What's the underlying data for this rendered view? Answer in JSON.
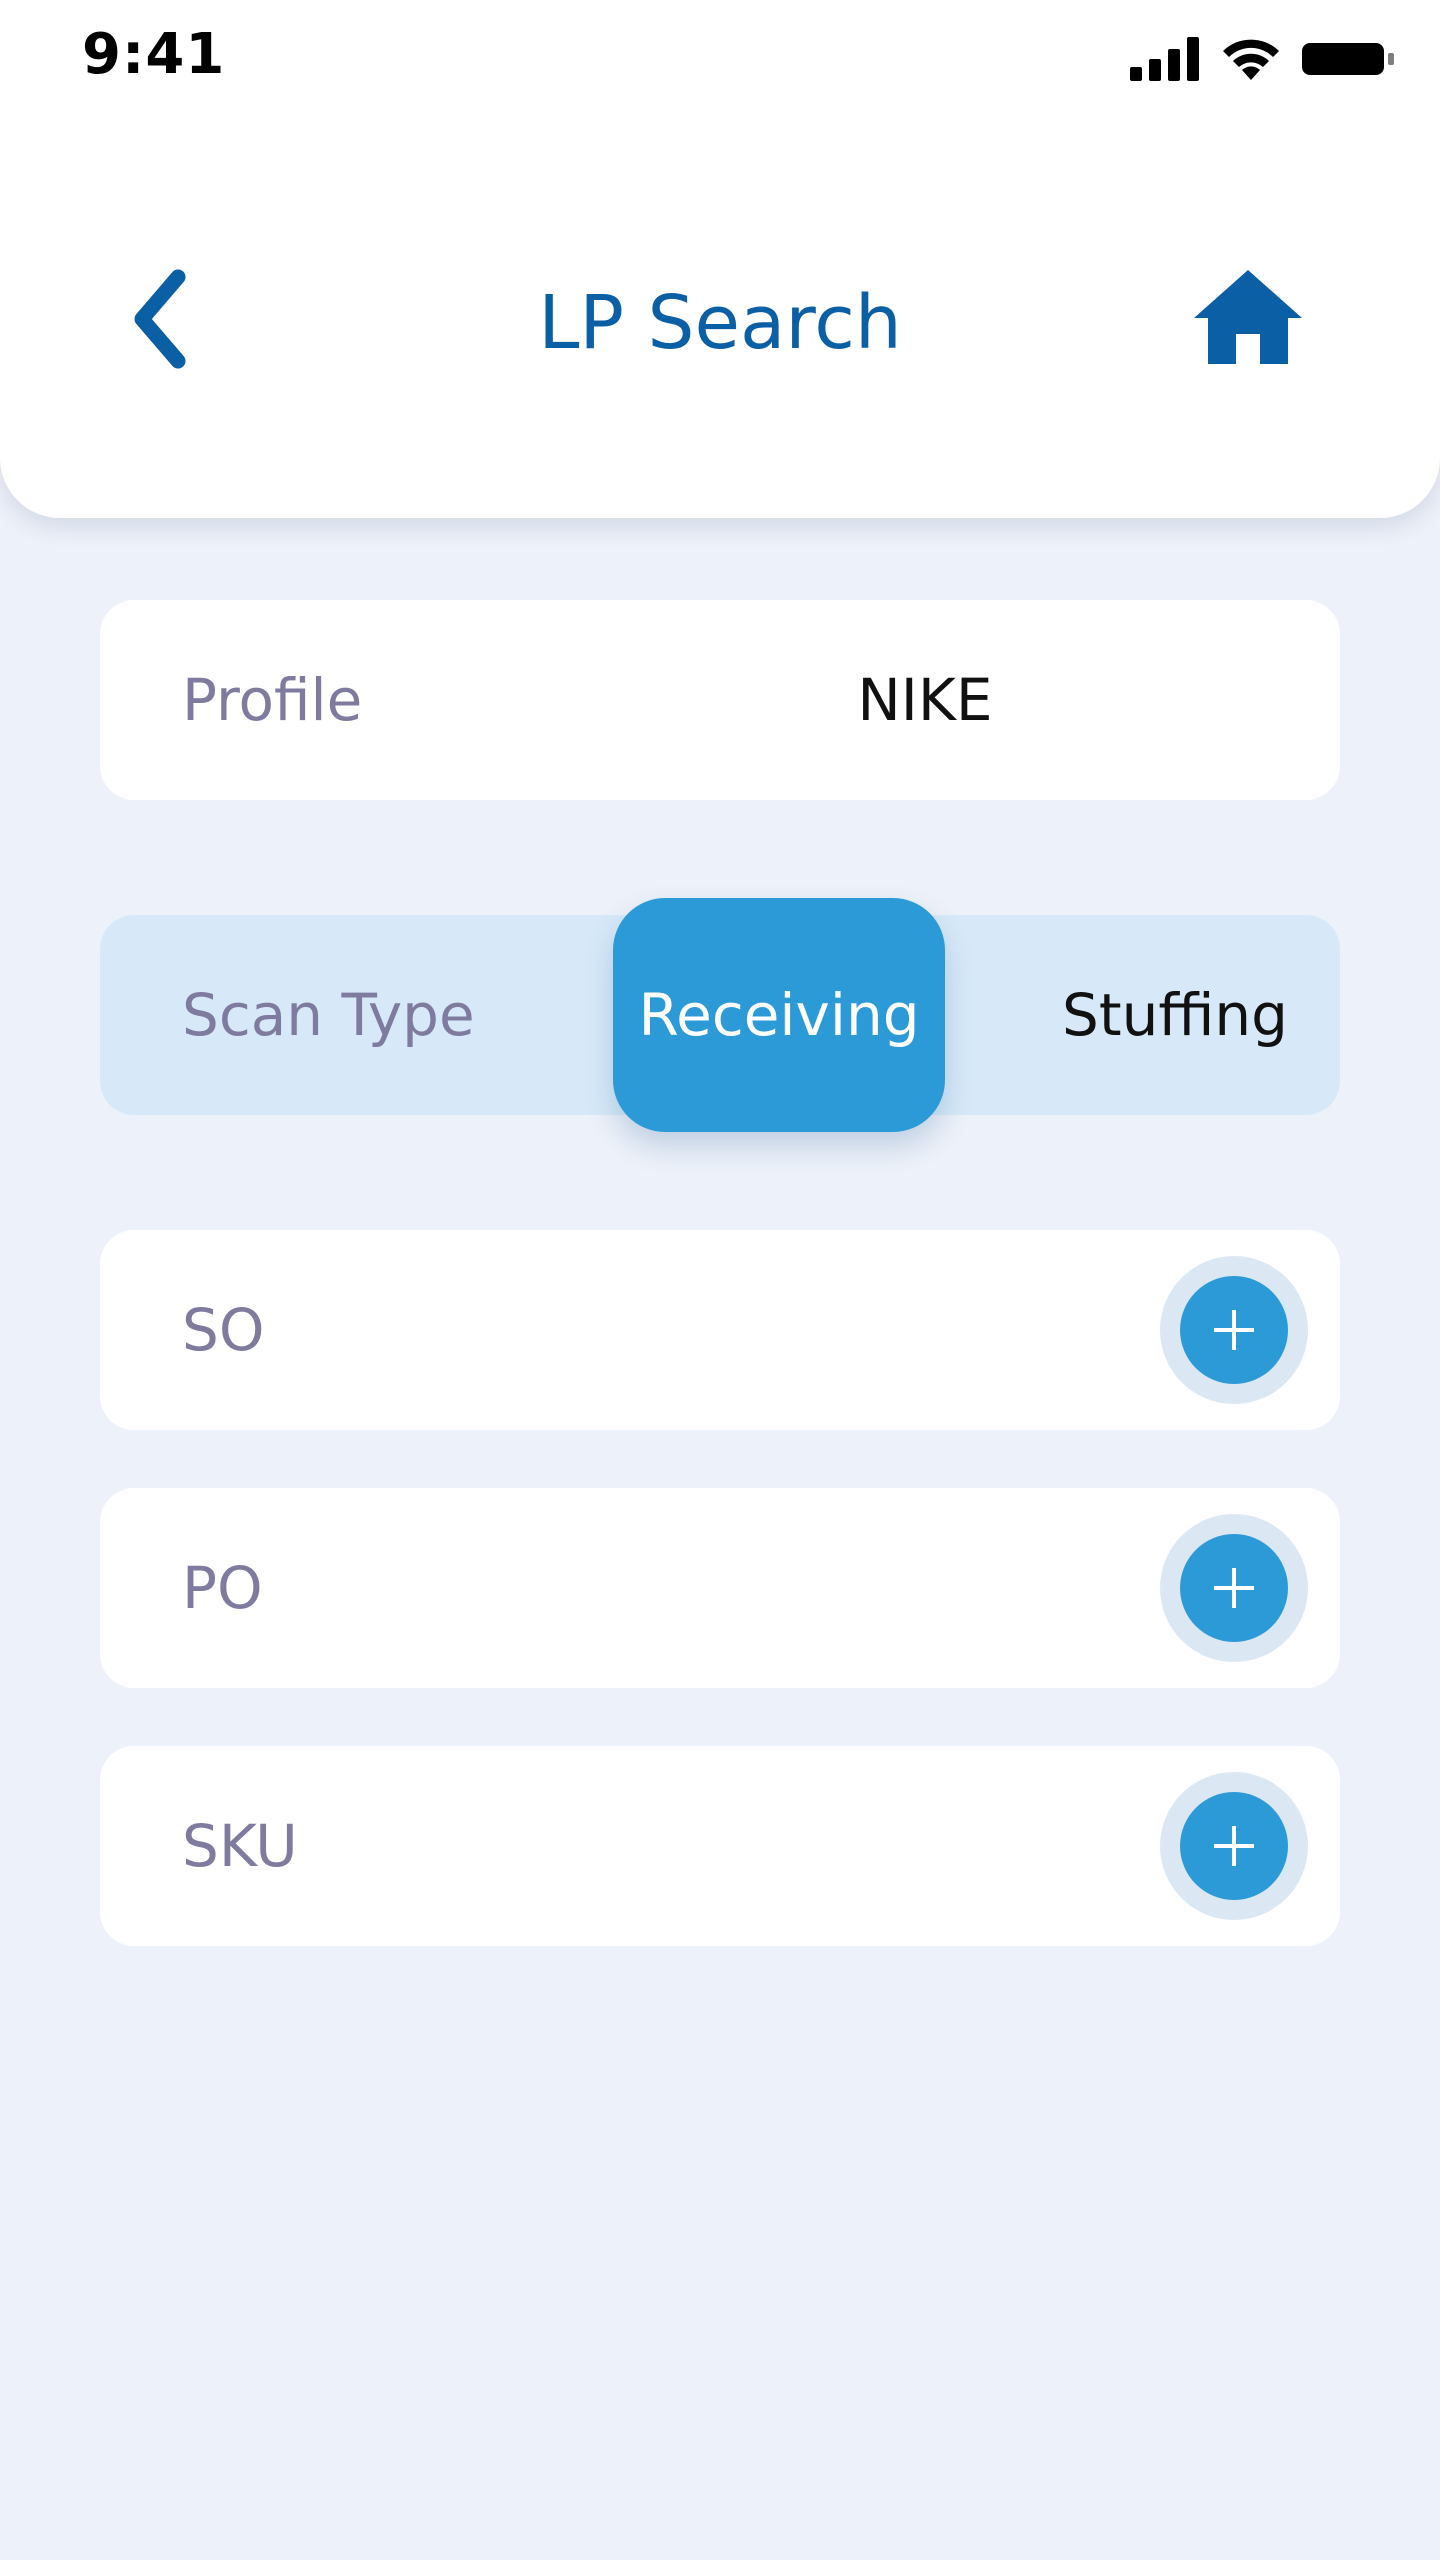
{
  "status_bar": {
    "time": "9:41",
    "icons": [
      "cellular-signal-icon",
      "wifi-icon",
      "battery-icon"
    ]
  },
  "header": {
    "title": "LP Search",
    "back_icon": "chevron-left-icon",
    "home_icon": "home-icon"
  },
  "profile": {
    "label": "Profile",
    "value": "NIKE"
  },
  "scan_type": {
    "label": "Scan Type",
    "options": [
      "Receiving",
      "Stuffing"
    ],
    "selected": "Receiving"
  },
  "fields": [
    {
      "label": "SO",
      "action_icon": "plus-icon"
    },
    {
      "label": "PO",
      "action_icon": "plus-icon"
    },
    {
      "label": "SKU",
      "action_icon": "plus-icon"
    }
  ],
  "colors": {
    "background": "#edf1f9",
    "accent": "#2d9ad8",
    "title": "#0b5fa5",
    "label": "#7e7b9f",
    "segment_bg": "#d7e9f8"
  }
}
